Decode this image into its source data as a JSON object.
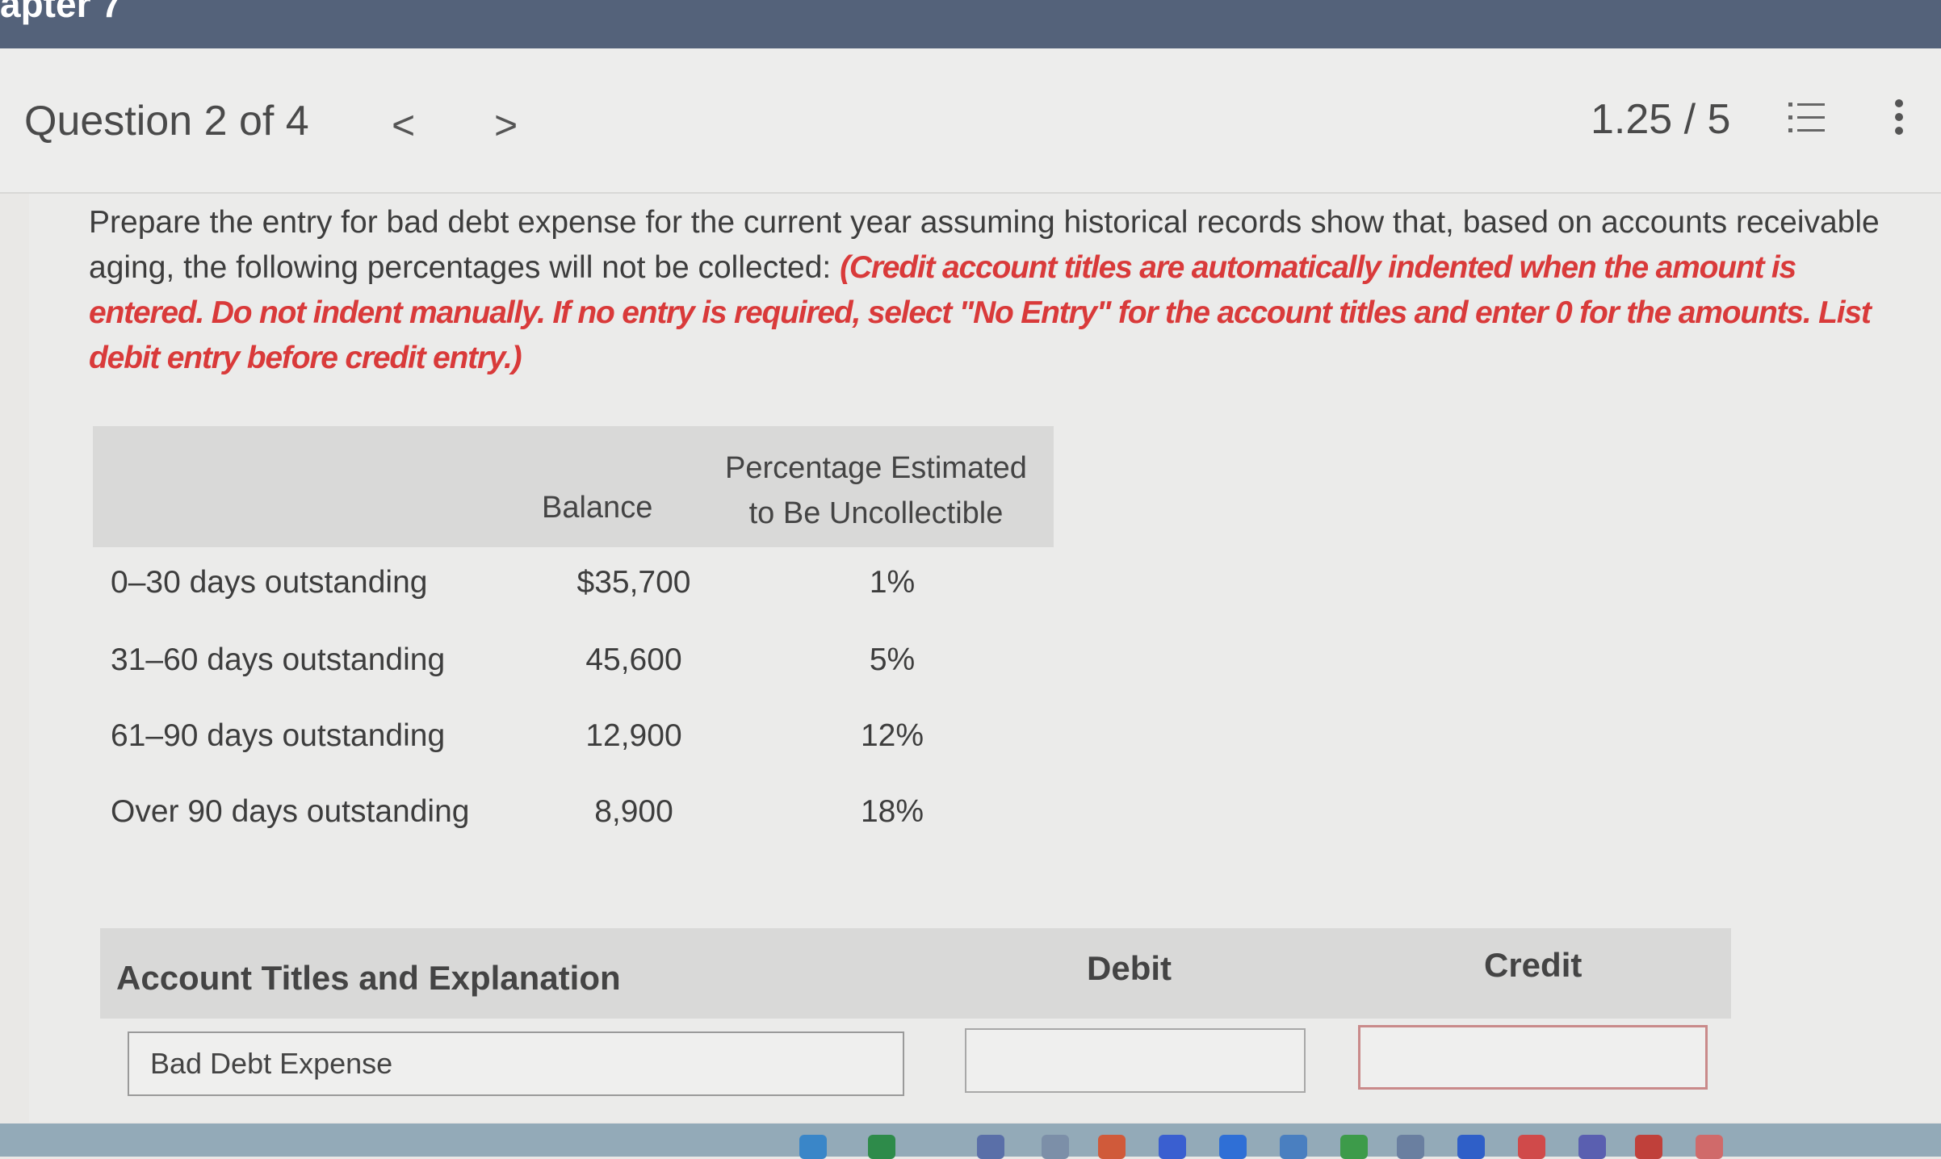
{
  "header": {
    "chapter_label": "apter 7",
    "question_title": "Question 2 of 4",
    "prev_glyph": "<",
    "next_glyph": ">",
    "score": "1.25 / 5"
  },
  "prompt": {
    "text": "Prepare the entry for bad debt expense for the current year assuming historical records show that, based on accounts receivable aging, the following percentages will not be collected: ",
    "instruction": "(Credit account titles are automatically indented when the amount is entered. Do not indent manually. If no entry is required, select \"No Entry\" for the account titles and enter 0 for the amounts. List debit entry before credit entry.)"
  },
  "aging_table": {
    "headers": {
      "balance": "Balance",
      "pct_line1": "Percentage Estimated",
      "pct_line2": "to Be Uncollectible"
    },
    "rows": [
      {
        "label": "0–30 days outstanding",
        "balance": "$35,700",
        "pct": "1%"
      },
      {
        "label": "31–60 days outstanding",
        "balance": "45,600",
        "pct": "5%"
      },
      {
        "label": "61–90 days outstanding",
        "balance": "12,900",
        "pct": "12%"
      },
      {
        "label": "Over 90 days outstanding",
        "balance": "8,900",
        "pct": "18%"
      }
    ]
  },
  "entry_table": {
    "headers": {
      "account": "Account Titles and Explanation",
      "debit": "Debit",
      "credit": "Credit"
    },
    "row": {
      "account_value": "Bad Debt Expense",
      "debit_value": "",
      "credit_value": ""
    }
  },
  "colors": {
    "top_bar": "#54627a",
    "instruction_red": "#d93a3a",
    "table_header": "#d9d9d8",
    "taskbar": "#93aab8"
  }
}
